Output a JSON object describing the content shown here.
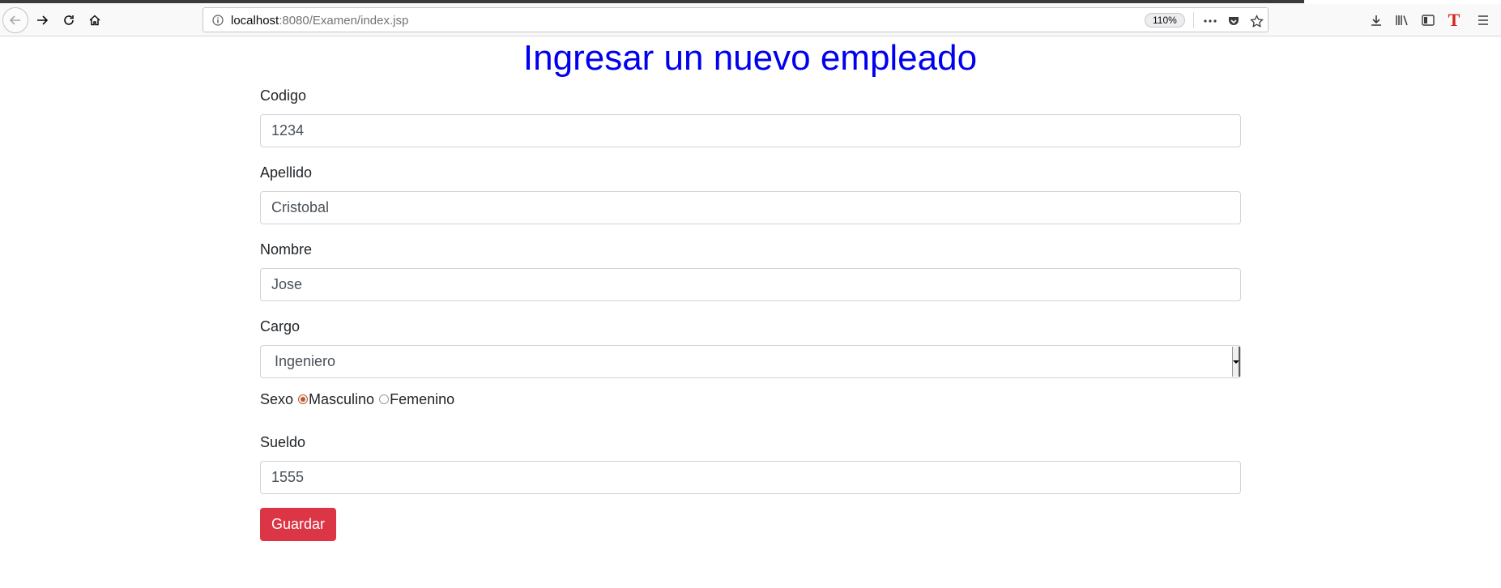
{
  "browser": {
    "url_host": "localhost",
    "url_rest": ":8080/Examen/index.jsp",
    "zoom": "110%"
  },
  "page": {
    "title": "Ingresar un nuevo empleado"
  },
  "form": {
    "codigo_label": "Codigo",
    "codigo_value": "1234",
    "apellido_label": "Apellido",
    "apellido_value": "Cristobal",
    "nombre_label": "Nombre",
    "nombre_value": "Jose",
    "cargo_label": "Cargo",
    "cargo_value": "Ingeniero",
    "sexo_label": "Sexo",
    "sexo_options": [
      "Masculino",
      "Femenino"
    ],
    "sexo_selected": "Masculino",
    "sueldo_label": "Sueldo",
    "sueldo_value": "1555",
    "save_label": "Guardar"
  },
  "colors": {
    "title": "#0000ee",
    "save_button": "#dc3545"
  }
}
